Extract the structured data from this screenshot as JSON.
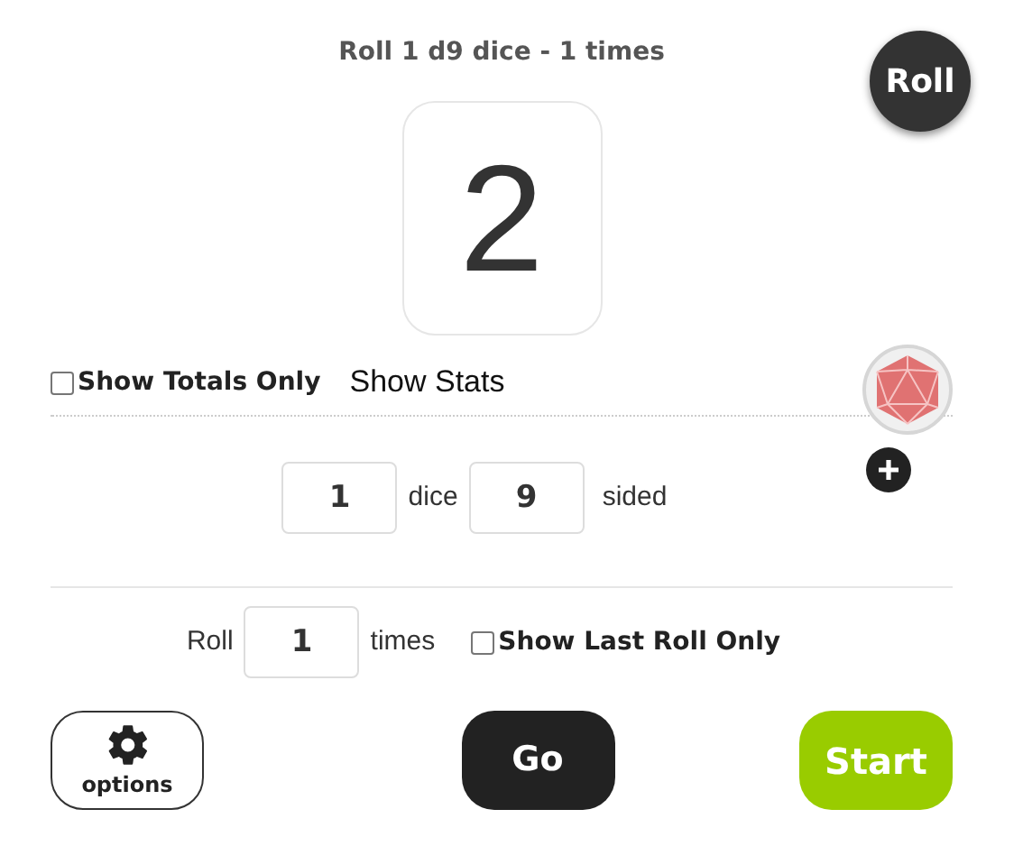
{
  "title": "Roll 1 d9 dice - 1 times",
  "roll_button": "Roll",
  "result": "2",
  "show_totals_only": {
    "label": "Show Totals Only",
    "checked": false
  },
  "show_stats": "Show Stats",
  "dice_row": {
    "count": "1",
    "count_label": "dice",
    "sides": "9",
    "sides_label": "sided"
  },
  "times_row": {
    "label": "Roll",
    "value": "1",
    "unit": "times"
  },
  "show_last_roll_only": {
    "label": "Show Last Roll Only",
    "checked": false
  },
  "options_button": "options",
  "go_button": "Go",
  "start_button": "Start"
}
